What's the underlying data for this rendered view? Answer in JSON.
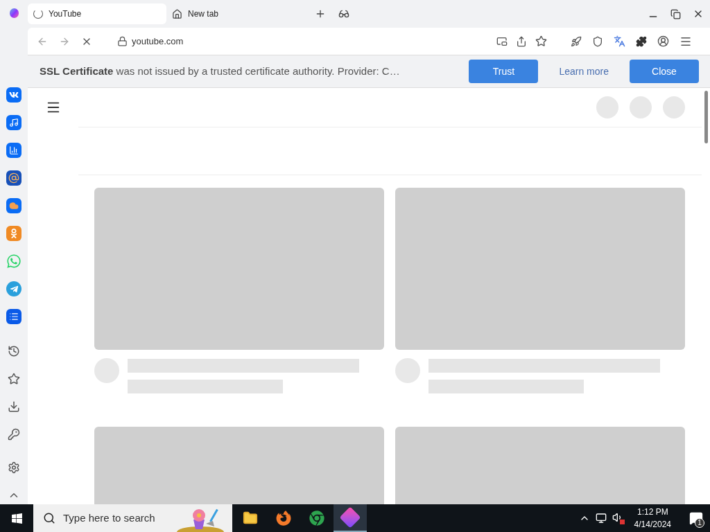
{
  "tabs": [
    {
      "label": "YouTube",
      "selected": true,
      "loading": true
    },
    {
      "label": "New tab",
      "selected": false,
      "loading": false
    }
  ],
  "address_bar": {
    "url": "youtube.com",
    "loading": true
  },
  "infobar": {
    "message": "**SSL Certificate** was not issued by a trusted certificate authority. Provider: C…",
    "buttons": [
      {
        "label": "Trust",
        "kind": "primary"
      },
      {
        "label": "Learn more",
        "kind": "link"
      },
      {
        "label": "Close",
        "kind": "primary"
      }
    ]
  },
  "taskbar": {
    "search": {
      "placeholder": "Type here to search"
    },
    "time": "1:12 PM",
    "date": "4/14/2024",
    "notifications": "1"
  }
}
